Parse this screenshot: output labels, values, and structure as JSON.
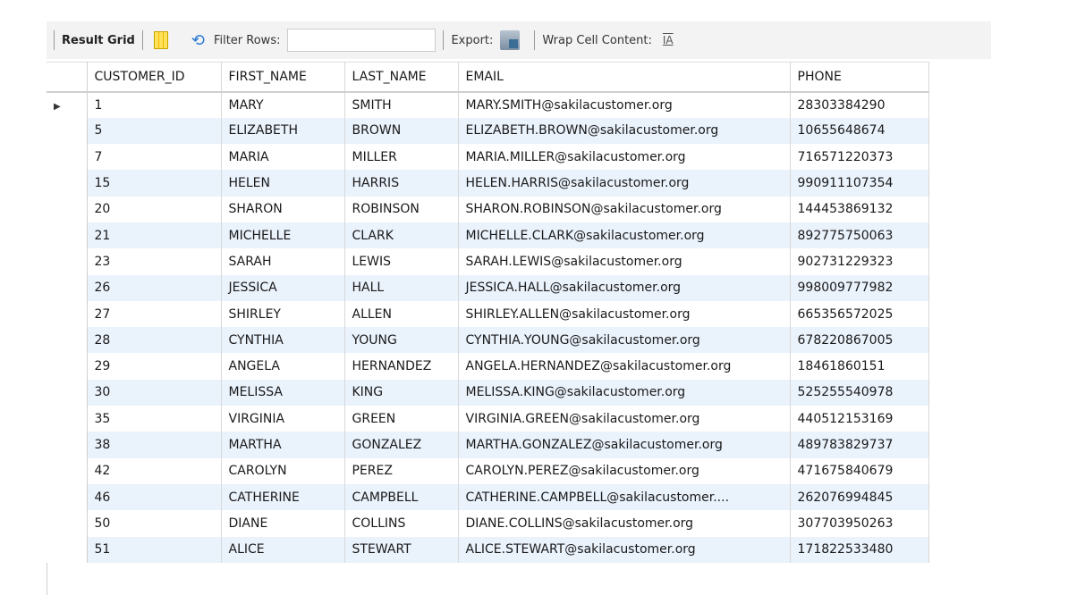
{
  "toolbar": {
    "result_grid": "Result Grid",
    "filter_rows": "Filter Rows:",
    "filter_value": "",
    "export": "Export:",
    "wrap_cell_content": "Wrap Cell Content:",
    "wrap_icon_glyph": "IA"
  },
  "columns": [
    "CUSTOMER_ID",
    "FIRST_NAME",
    "LAST_NAME",
    "EMAIL",
    "PHONE"
  ],
  "rows": [
    [
      "1",
      "MARY",
      "SMITH",
      "MARY.SMITH@sakilacustomer.org",
      "28303384290"
    ],
    [
      "5",
      "ELIZABETH",
      "BROWN",
      "ELIZABETH.BROWN@sakilacustomer.org",
      "10655648674"
    ],
    [
      "7",
      "MARIA",
      "MILLER",
      "MARIA.MILLER@sakilacustomer.org",
      "716571220373"
    ],
    [
      "15",
      "HELEN",
      "HARRIS",
      "HELEN.HARRIS@sakilacustomer.org",
      "990911107354"
    ],
    [
      "20",
      "SHARON",
      "ROBINSON",
      "SHARON.ROBINSON@sakilacustomer.org",
      "144453869132"
    ],
    [
      "21",
      "MICHELLE",
      "CLARK",
      "MICHELLE.CLARK@sakilacustomer.org",
      "892775750063"
    ],
    [
      "23",
      "SARAH",
      "LEWIS",
      "SARAH.LEWIS@sakilacustomer.org",
      "902731229323"
    ],
    [
      "26",
      "JESSICA",
      "HALL",
      "JESSICA.HALL@sakilacustomer.org",
      "998009777982"
    ],
    [
      "27",
      "SHIRLEY",
      "ALLEN",
      "SHIRLEY.ALLEN@sakilacustomer.org",
      "665356572025"
    ],
    [
      "28",
      "CYNTHIA",
      "YOUNG",
      "CYNTHIA.YOUNG@sakilacustomer.org",
      "678220867005"
    ],
    [
      "29",
      "ANGELA",
      "HERNANDEZ",
      "ANGELA.HERNANDEZ@sakilacustomer.org",
      "18461860151"
    ],
    [
      "30",
      "MELISSA",
      "KING",
      "MELISSA.KING@sakilacustomer.org",
      "525255540978"
    ],
    [
      "35",
      "VIRGINIA",
      "GREEN",
      "VIRGINIA.GREEN@sakilacustomer.org",
      "440512153169"
    ],
    [
      "38",
      "MARTHA",
      "GONZALEZ",
      "MARTHA.GONZALEZ@sakilacustomer.org",
      "489783829737"
    ],
    [
      "42",
      "CAROLYN",
      "PEREZ",
      "CAROLYN.PEREZ@sakilacustomer.org",
      "471675840679"
    ],
    [
      "46",
      "CATHERINE",
      "CAMPBELL",
      "CATHERINE.CAMPBELL@sakilacustomer....",
      "262076994845"
    ],
    [
      "50",
      "DIANE",
      "COLLINS",
      "DIANE.COLLINS@sakilacustomer.org",
      "307703950263"
    ],
    [
      "51",
      "ALICE",
      "STEWART",
      "ALICE.STEWART@sakilacustomer.org",
      "171822533480"
    ]
  ],
  "selected_row_marker": "▶",
  "colors": {
    "alt_row": "#eaf2fc",
    "toolbar_bg": "#f3f3f3"
  }
}
